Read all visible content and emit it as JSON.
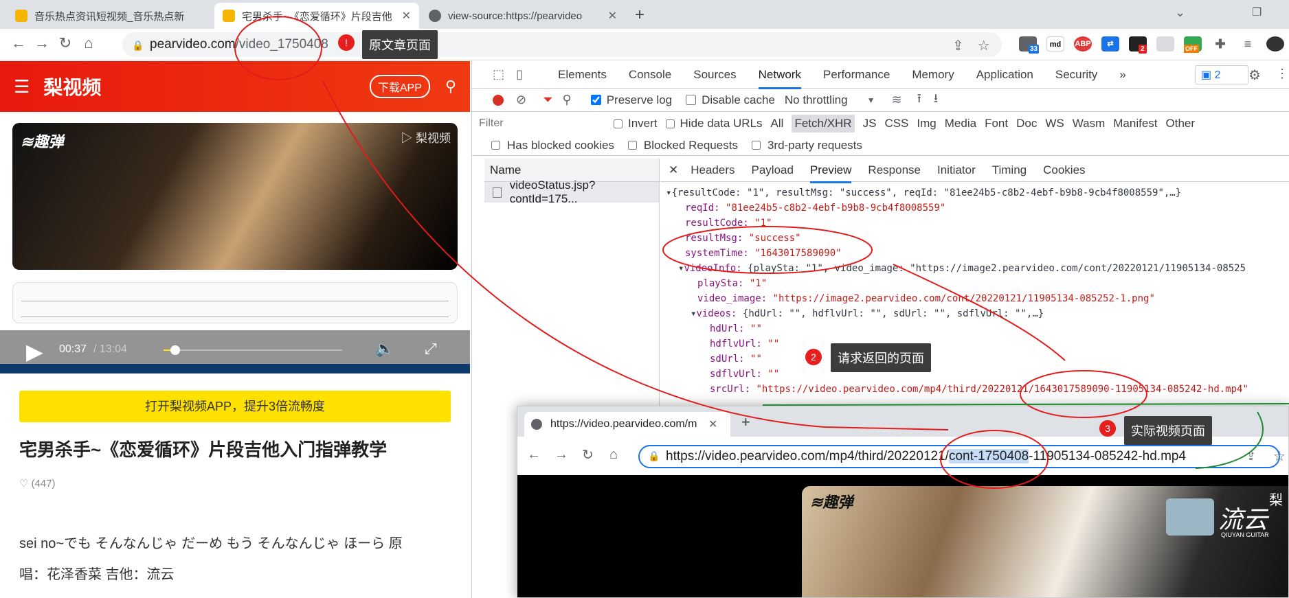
{
  "tabs": [
    {
      "title": "音乐热点资讯短视频_音乐热点新"
    },
    {
      "title": "宅男杀手~《恋爱循环》片段吉他"
    },
    {
      "title": "view-source:https://pearvideo"
    }
  ],
  "address": {
    "host": "pearvideo.com",
    "path": "/video_1750408"
  },
  "annotations": {
    "a1": "原文章页面",
    "a2": "请求返回的页面",
    "a3": "实际视频页面",
    "n1": "!",
    "n2": "2",
    "n3": "3"
  },
  "ext_badges": {
    "b1": "33",
    "b2": "2",
    "b3": "OFF"
  },
  "site": {
    "logo": "梨视频",
    "download": "下载APP",
    "watermark": "梨视频",
    "brand": "趣弹",
    "time_current": "00:37",
    "time_total": "/ 13:04",
    "open_app": "打开梨视频APP，提升3倍流畅度",
    "title": "宅男杀手~《恋爱循环》片段吉他入门指弹教学",
    "likes": "(447)",
    "desc_line1": "sei no~でも そんなんじゃ だーめ もう そんなんじゃ ほーら 原",
    "desc_line2": "唱：花泽香菜 吉他：流云"
  },
  "devtools": {
    "tabs": [
      "Elements",
      "Console",
      "Sources",
      "Network",
      "Performance",
      "Memory",
      "Application",
      "Security"
    ],
    "active_tab": "Network",
    "msg_count": "2",
    "preserve_log": "Preserve log",
    "disable_cache": "Disable cache",
    "throttle": "No throttling",
    "filter_placeholder": "Filter",
    "invert": "Invert",
    "hide_data": "Hide data URLs",
    "types": [
      "All",
      "Fetch/XHR",
      "JS",
      "CSS",
      "Img",
      "Media",
      "Font",
      "Doc",
      "WS",
      "Wasm",
      "Manifest",
      "Other"
    ],
    "active_type": "Fetch/XHR",
    "blocked_cookies": "Has blocked cookies",
    "blocked_req": "Blocked Requests",
    "third_party": "3rd-party requests",
    "name_col": "Name",
    "request": "videoStatus.jsp?contId=175...",
    "detail_tabs": [
      "Headers",
      "Payload",
      "Preview",
      "Response",
      "Initiator",
      "Timing",
      "Cookies"
    ],
    "active_detail": "Preview",
    "json": {
      "root": "{resultCode: \"1\", resultMsg: \"success\", reqId: \"81ee24b5-c8b2-4ebf-b9b8-9cb4f8008559\",…}",
      "reqId_k": "reqId:",
      "reqId_v": "\"81ee24b5-c8b2-4ebf-b9b8-9cb4f8008559\"",
      "resultCode_k": "resultCode:",
      "resultCode_v": "\"1\"",
      "resultMsg_k": "resultMsg:",
      "resultMsg_v": "\"success\"",
      "systemTime_k": "systemTime:",
      "systemTime_v": "\"1643017589090\"",
      "videoInfo_k": "videoInfo:",
      "videoInfo_v": "{playSta: \"1\", video_image: \"https://image2.pearvideo.com/cont/20220121/11905134-08525",
      "playSta_k": "playSta:",
      "playSta_v": "\"1\"",
      "video_image_k": "video_image:",
      "video_image_v": "\"https://image2.pearvideo.com/cont/20220121/11905134-085252-1.png\"",
      "videos_k": "videos:",
      "videos_v": "{hdUrl: \"\", hdflvUrl: \"\", sdUrl: \"\", sdflvUrl: \"\",…}",
      "hdUrl_k": "hdUrl:",
      "hdUrl_v": "\"\"",
      "hdflvUrl_k": "hdflvUrl:",
      "hdflvUrl_v": "\"\"",
      "sdUrl_k": "sdUrl:",
      "sdUrl_v": "\"\"",
      "sdflvUrl_k": "sdflvUrl:",
      "sdflvUrl_v": "\"\"",
      "srcUrl_k": "srcUrl:",
      "srcUrl_v": "\"https://video.pearvideo.com/mp4/third/20220121/1643017589090-11905134-085242-hd.mp4\""
    }
  },
  "popup": {
    "tab_title": "https://video.pearvideo.com/m",
    "url_pre": "https://video.pearvideo.com/mp4/third/20220121/",
    "url_sel": "cont-1750408",
    "url_post": "-11905134-085242-hd.mp4",
    "artist": "流云",
    "artist_sub": "QIUYAN GUITAR",
    "brand": "趣弹",
    "corner": "梨"
  }
}
